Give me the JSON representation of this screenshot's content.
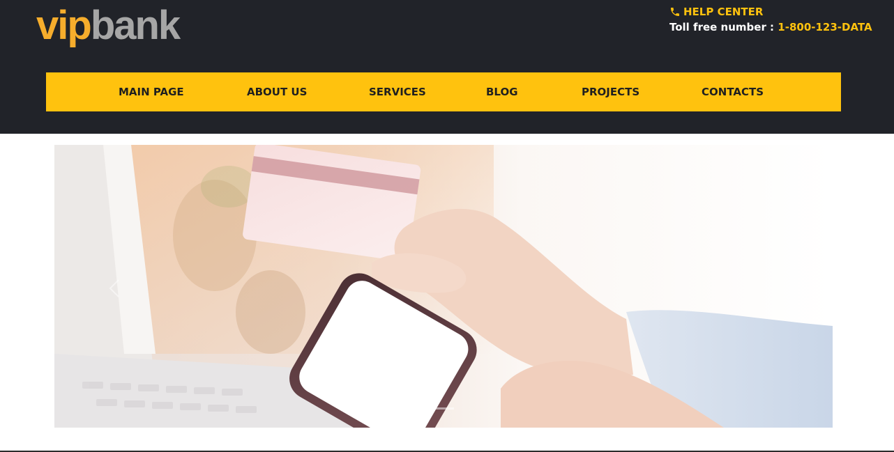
{
  "brand": {
    "logo_part1": "vip",
    "logo_part2": "bank",
    "color_accent": "#ffc20e",
    "color_logo_vip": "#f6ad2c",
    "color_logo_bank": "#a6a6a6",
    "color_header_bg": "#212329"
  },
  "help": {
    "icon": "phone-icon",
    "title": "HELP CENTER",
    "toll_label": "Toll free number : ",
    "toll_number": "1-800-123-DATA"
  },
  "nav": {
    "items": [
      {
        "label": "MAIN PAGE"
      },
      {
        "label": "ABOUT US"
      },
      {
        "label": "SERVICES"
      },
      {
        "label": "BLOG"
      },
      {
        "label": "PROJECTS"
      },
      {
        "label": "CONTACTS"
      }
    ]
  },
  "slider": {
    "active_slide": 1,
    "slide_count": 2,
    "prev_icon": "chevron-left-icon"
  }
}
